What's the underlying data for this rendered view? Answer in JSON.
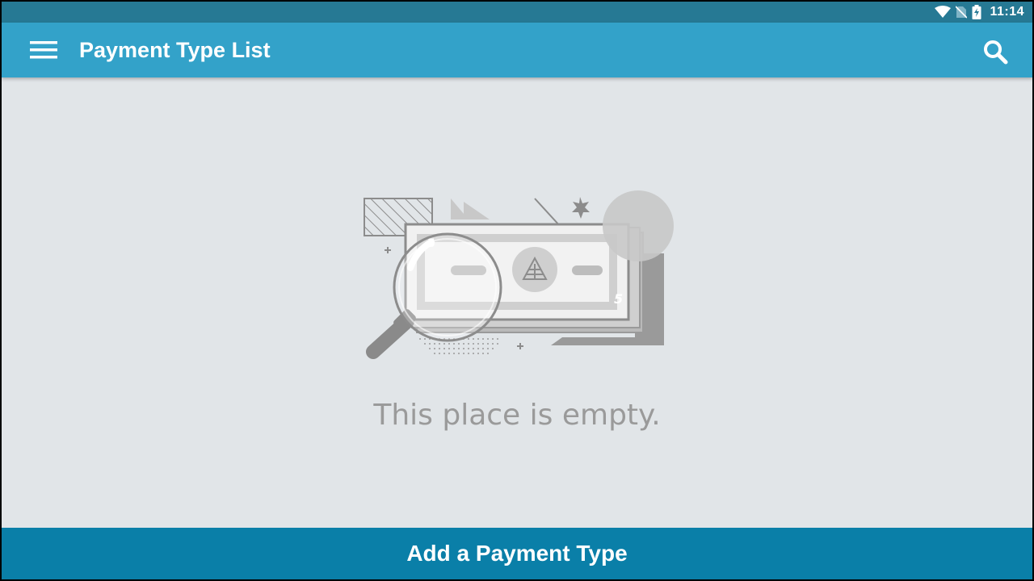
{
  "status_bar": {
    "time": "11:14",
    "icons": [
      "wifi-icon",
      "no-sim-icon",
      "battery-charging-icon"
    ]
  },
  "app_bar": {
    "title": "Payment Type List",
    "menu_icon": "menu-icon",
    "search_icon": "search-icon",
    "background": "#33a2c9"
  },
  "empty_state": {
    "illustration": "money-magnifier-illustration",
    "message": "This place is empty."
  },
  "footer": {
    "add_button_label": "Add a Payment Type",
    "background": "#0a7fa8"
  }
}
